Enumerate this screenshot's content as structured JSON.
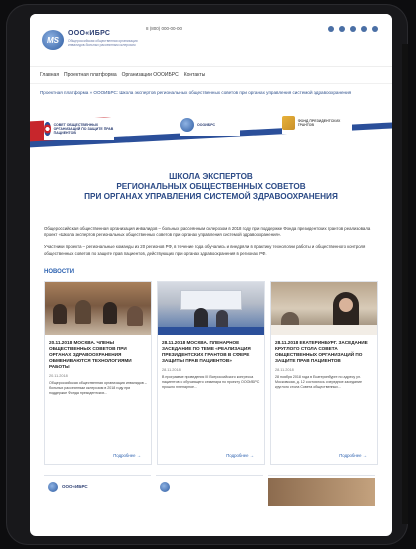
{
  "header": {
    "logo_letters": "MS",
    "brand": "ООО«ИБРС",
    "tagline": "Общероссийская общественная организация инвалидов-больных рассеянным склерозом",
    "phone": "8 (800) 000-00-00"
  },
  "nav": {
    "items": [
      "Главная",
      "Проектная платформа",
      "Организации ОООИБРС",
      "Контакты"
    ]
  },
  "breadcrumb": "Проектная платформа  »  ОООИБРС: Школа экспертов региональных общественных советов при органах управления системой здравоохранения",
  "banner": {
    "partner1_name": "СОВЕТ ОБЩЕСТВЕННЫХ ОРГАНИЗАЦИЙ ПО ЗАЩИТЕ ПРАВ ПАЦИЕНТОВ",
    "partner2_name": "ОООИБРС",
    "partner3_name": "ФОНД ПРЕЗИДЕНТСКИХ ГРАНТОВ",
    "title_line1": "ШКОЛА ЭКСПЕРТОВ",
    "title_line2": "РЕГИОНАЛЬНЫХ ОБЩЕСТВЕННЫХ СОВЕТОВ",
    "title_line3": "ПРИ ОРГАНАХ УПРАВЛЕНИЯ СИСТЕМОЙ ЗДРАВООХРАНЕНИЯ"
  },
  "intro": {
    "p1": "Общероссийская общественная организация инвалидов – больных рассеянным склерозом в 2018 году при поддержке Фонда президентских грантов реализовала проект «Школа экспертов региональных общественных советов при органах управления системой здравоохранения».",
    "p2": "Участники проекта – региональные команды из 20 регионов РФ, в течение года обучались и внедряли в практику технологии работы и общественного контроля общественных советов по защите прав пациентов, действующих при органах здравоохранения в регионах РФ."
  },
  "news": {
    "title": "НОВОСТИ",
    "more_label": "Подробнее  →",
    "items": [
      {
        "title": "20.11.2018 МОСКВА. ЧЛЕНЫ ОБЩЕСТВЕННЫХ СОВЕТОВ ПРИ ОРГАНАХ ЗДРАВООХРАНЕНИЯ ОБМЕНИВАЮТСЯ ТЕХНОЛОГИЯМИ РАБОТЫ",
        "date": "20.11.2018",
        "text": "Общероссийская общественная организация инвалидов – больных рассеянным склерозом в 2018 году при поддержке Фонда президентских..."
      },
      {
        "title": "28.11.2018 МОСКВА. ПЛЕНАРНОЕ ЗАСЕДАНИЕ ПО ТЕМЕ «РЕАЛИЗАЦИЯ ПРЕЗИДЕНТСКИХ ГРАНТОВ В СФЕРЕ ЗАЩИТЫ ПРАВ ПАЦИЕНТОВ»",
        "date": "28.11.2018",
        "text": "В программе проведения III Всероссийского конгресса пациентов с обучающего семинара по проекту ОООИБРС прошло пленарное..."
      },
      {
        "title": "28.11.2018 ЕКАТЕРИНБУРГ. ЗАСЕДАНИЕ КРУГЛОГО СТОЛА СОВЕТА ОБЩЕСТВЕННЫХ ОРГАНИЗАЦИЙ ПО ЗАЩИТЕ ПРАВ ПАЦИЕНТОВ",
        "date": "28.11.2018",
        "text": "28 ноября 2018 года в Екатеринбурге по адресу ул. Московская, д. 12 состоялось очередное заседание круглого стола Совета общественных..."
      }
    ]
  },
  "colors": {
    "accent": "#2d62b0",
    "brand_red": "#c7262c",
    "brand_blue": "#2b4f9a"
  }
}
